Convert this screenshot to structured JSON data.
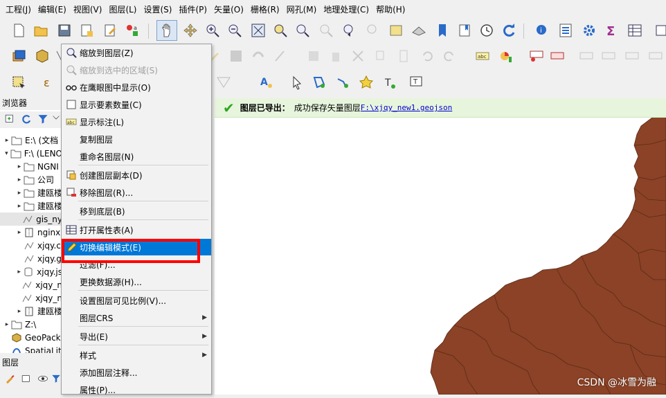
{
  "menubar": [
    "工程(J)",
    "编辑(E)",
    "视图(V)",
    "图层(L)",
    "设置(S)",
    "插件(P)",
    "矢量(O)",
    "栅格(R)",
    "网孔(M)",
    "地理处理(C)",
    "帮助(H)"
  ],
  "browser": {
    "title": "浏览器",
    "items": [
      {
        "label": "E:\\ (文档",
        "expander": "▸",
        "icon": "folder-icon"
      },
      {
        "label": "F:\\ (LENO",
        "expander": "▾",
        "icon": "folder-icon"
      },
      {
        "label": "NGNI",
        "expander": "▸",
        "icon": "folder-icon"
      },
      {
        "label": "公司",
        "expander": "▸",
        "icon": "folder-icon"
      },
      {
        "label": "建瓯楼",
        "expander": "▸",
        "icon": "folder-icon"
      },
      {
        "label": "建瓯楼",
        "expander": "▸",
        "icon": "folder-icon"
      },
      {
        "label": "gis_ny",
        "expander": "",
        "icon": "vector-layer-icon"
      },
      {
        "label": "nginx",
        "expander": "▸",
        "icon": "archive-icon"
      },
      {
        "label": "xjqy.c",
        "expander": "",
        "icon": "vector-layer-icon"
      },
      {
        "label": "xjqy.g",
        "expander": "",
        "icon": "vector-layer-icon"
      },
      {
        "label": "xjqy.js",
        "expander": "▸",
        "icon": "database-icon"
      },
      {
        "label": "xjqy_n",
        "expander": "",
        "icon": "vector-layer-icon"
      },
      {
        "label": "xjqy_n",
        "expander": "",
        "icon": "vector-layer-icon"
      },
      {
        "label": "建瓯楼",
        "expander": "▸",
        "icon": "archive-icon"
      },
      {
        "label": "Z:\\",
        "expander": "▸",
        "icon": "folder-icon"
      },
      {
        "label": "GeoPack",
        "expander": "",
        "icon": "geopackage-icon"
      },
      {
        "label": "SpatiaLit",
        "expander": "",
        "icon": "spatialite-icon"
      }
    ]
  },
  "layers": {
    "title": "图层"
  },
  "message_bar": {
    "title": "图层已导出：",
    "text": "成功保存矢量图层",
    "path": "F:\\xjqy_new1.geojson"
  },
  "context_menu": [
    {
      "label": "缩放到图层(Z)",
      "icon": "zoom-layer-icon",
      "state": "normal"
    },
    {
      "label": "缩放到选中的区域(S)",
      "icon": "zoom-selection-icon",
      "state": "disabled"
    },
    {
      "label": "在鹰眼图中显示(O)",
      "icon": "overview-icon",
      "state": "normal"
    },
    {
      "label": "显示要素数量(C)",
      "icon": "checkbox-icon",
      "state": "normal"
    },
    {
      "label": "显示标注(L)",
      "icon": "label-icon",
      "state": "normal"
    },
    {
      "label": "复制图层",
      "icon": "",
      "state": "normal"
    },
    {
      "label": "重命名图层(N)",
      "icon": "",
      "state": "normal"
    },
    {
      "label": "创建图层副本(D)",
      "icon": "duplicate-icon",
      "state": "normal"
    },
    {
      "label": "移除图层(R)...",
      "icon": "remove-layer-icon",
      "state": "normal"
    },
    {
      "label": "移到底层(B)",
      "icon": "",
      "state": "normal"
    },
    {
      "label": "打开属性表(A)",
      "icon": "table-icon",
      "state": "normal"
    },
    {
      "label": "切换编辑模式(E)",
      "icon": "pencil-icon",
      "state": "highlighted"
    },
    {
      "label": "过滤(F)...",
      "icon": "",
      "state": "normal"
    },
    {
      "label": "更换数据源(H)...",
      "icon": "",
      "state": "normal"
    },
    {
      "label": "设置图层可见比例(V)...",
      "icon": "",
      "state": "normal"
    },
    {
      "label": "图层CRS",
      "icon": "",
      "state": "submenu"
    },
    {
      "label": "导出(E)",
      "icon": "",
      "state": "submenu"
    },
    {
      "label": "样式",
      "icon": "",
      "state": "submenu"
    },
    {
      "label": "添加图层注释...",
      "icon": "",
      "state": "normal"
    },
    {
      "label": "属性(P)...",
      "icon": "",
      "state": "normal"
    }
  ],
  "colors": {
    "map_fill": "#8b4226",
    "highlight": "#0078d7",
    "annotation_box": "#ff0000",
    "message_bg": "#e7f5dd"
  },
  "watermark": "CSDN @冰雪为融"
}
